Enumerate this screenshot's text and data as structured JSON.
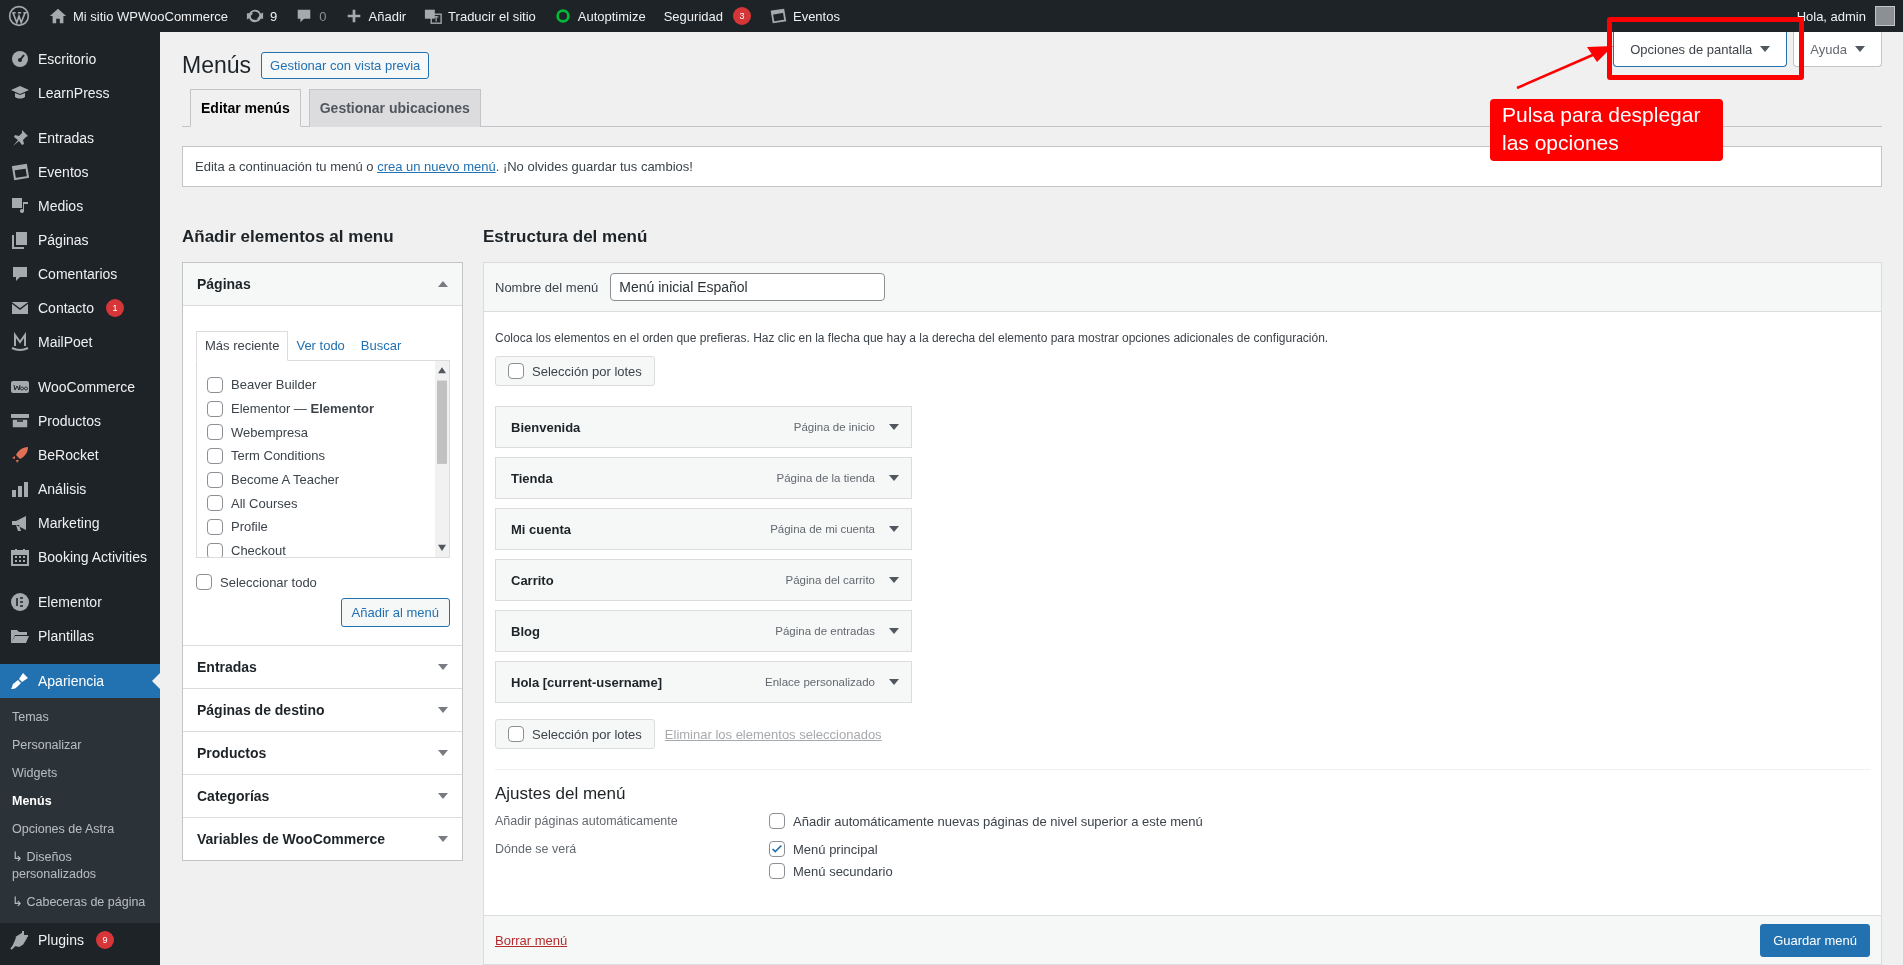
{
  "admin_bar": {
    "items": [
      {
        "kind": "home",
        "label": "Mi sitio WPWooCommerce",
        "muted": false
      },
      {
        "kind": "updates",
        "label": "9",
        "muted": false
      },
      {
        "kind": "comment",
        "label": "0",
        "muted": true
      },
      {
        "kind": "plus",
        "label": "Añadir",
        "muted": false
      },
      {
        "kind": "translate",
        "label": "Traducir el sitio",
        "muted": false
      },
      {
        "kind": "ring",
        "label": "Autoptimize",
        "muted": false
      },
      {
        "kind": "none",
        "label": "Seguridad",
        "badge": "3",
        "muted": false
      },
      {
        "kind": "calendar",
        "label": "Eventos",
        "muted": false
      }
    ],
    "greeting": "Hola, admin"
  },
  "sidebar": {
    "groups": [
      [
        {
          "kind": "gauge",
          "label": "Escritorio",
          "selected": false
        },
        {
          "kind": "cap",
          "label": "LearnPress",
          "selected": false
        }
      ],
      [
        {
          "kind": "pin",
          "label": "Entradas",
          "selected": false
        },
        {
          "kind": "calendar",
          "label": "Eventos",
          "selected": false
        },
        {
          "kind": "media",
          "label": "Medios",
          "selected": false
        },
        {
          "kind": "pages",
          "label": "Páginas",
          "selected": false
        },
        {
          "kind": "comment",
          "label": "Comentarios",
          "selected": false
        },
        {
          "kind": "mail",
          "label": "Contacto",
          "badge": "1",
          "selected": false
        },
        {
          "kind": "mletter",
          "label": "MailPoet",
          "selected": false
        }
      ],
      [
        {
          "kind": "woo",
          "label": "WooCommerce",
          "selected": false
        },
        {
          "kind": "archive",
          "label": "Productos",
          "selected": false
        },
        {
          "kind": "rocket",
          "label": "BeRocket",
          "selected": false
        },
        {
          "kind": "bars",
          "label": "Análisis",
          "selected": false
        },
        {
          "kind": "megaphone",
          "label": "Marketing",
          "selected": false
        },
        {
          "kind": "grid",
          "label": "Booking Activities",
          "selected": false
        }
      ],
      [
        {
          "kind": "elementor",
          "label": "Elementor",
          "selected": false
        },
        {
          "kind": "folder",
          "label": "Plantillas",
          "selected": false
        }
      ],
      [
        {
          "kind": "brush",
          "label": "Apariencia",
          "selected": true,
          "children": [
            {
              "label": "Temas",
              "selected": false
            },
            {
              "label": "Personalizar",
              "selected": false
            },
            {
              "label": "Widgets",
              "selected": false
            },
            {
              "label": "Menús",
              "selected": true
            },
            {
              "label": "Opciones de Astra",
              "selected": false
            },
            {
              "label": "↳ Diseños personalizados",
              "selected": false
            },
            {
              "label": "↳ Cabeceras de página",
              "selected": false
            }
          ]
        },
        {
          "kind": "plug",
          "label": "Plugins",
          "badge": "9",
          "selected": false
        }
      ]
    ]
  },
  "header": {
    "title": "Menús",
    "preview_button": "Gestionar con vista previa",
    "screen_options": "Opciones de pantalla",
    "help": "Ayuda"
  },
  "tabs": [
    {
      "label": "Editar menús",
      "selected": true
    },
    {
      "label": "Gestionar ubicaciones",
      "selected": false
    }
  ],
  "notice": {
    "before": "Edita a continuación tu menú o ",
    "link": "crea un nuevo menú",
    "after": ". ¡No olvides guardar tus cambios!"
  },
  "add_items": {
    "heading": "Añadir elementos al menu",
    "sections": [
      {
        "title": "Páginas",
        "expanded": true,
        "tabs": [
          {
            "label": "Más reciente",
            "selected": true
          },
          {
            "label": "Ver todo",
            "selected": false
          },
          {
            "label": "Buscar",
            "selected": false
          }
        ],
        "pages": [
          {
            "label": "Beaver Builder",
            "checked": false
          },
          {
            "label": "Elementor — **Elementor**",
            "checked": false
          },
          {
            "label": "Webempresa",
            "checked": false
          },
          {
            "label": "Term Conditions",
            "checked": false
          },
          {
            "label": "Become A Teacher",
            "checked": false
          },
          {
            "label": "All Courses",
            "checked": false
          },
          {
            "label": "Profile",
            "checked": false
          },
          {
            "label": "Checkout",
            "checked": false
          }
        ],
        "select_all": {
          "label": "Seleccionar todo",
          "checked": false
        },
        "add_button": "Añadir al menú"
      },
      {
        "title": "Entradas",
        "expanded": false
      },
      {
        "title": "Páginas de destino",
        "expanded": false
      },
      {
        "title": "Productos",
        "expanded": false
      },
      {
        "title": "Categorías",
        "expanded": false
      },
      {
        "title": "Variables de WooCommerce",
        "expanded": false
      }
    ]
  },
  "structure": {
    "heading": "Estructura del menú",
    "name_label": "Nombre del menú",
    "name_value": "Menú inicial Español",
    "instructions": "Coloca los elementos en el orden que prefieras. Haz clic en la flecha que hay a la derecha del elemento para mostrar opciones adicionales de configuración.",
    "bulk_top": {
      "label": "Selección por lotes",
      "checked": false
    },
    "items": [
      {
        "title": "Bienvenida",
        "type": "Página de inicio"
      },
      {
        "title": "Tienda",
        "type": "Página de la tienda"
      },
      {
        "title": "Mi cuenta",
        "type": "Página de mi cuenta"
      },
      {
        "title": "Carrito",
        "type": "Página del carrito"
      },
      {
        "title": "Blog",
        "type": "Página de entradas"
      },
      {
        "title": "Hola [current-username]",
        "type": "Enlace personalizado"
      }
    ],
    "bulk_bottom": {
      "label": "Selección por lotes",
      "checked": false
    },
    "remove_link": {
      "label": "Eliminar los elementos seleccionados",
      "disabled": true
    },
    "settings": {
      "heading": "Ajustes del menú",
      "rows": [
        {
          "label": "Añadir páginas automáticamente",
          "options": [
            {
              "label": "Añadir automáticamente nuevas páginas de nivel superior a este menú",
              "checked": false
            }
          ]
        },
        {
          "label": "Dónde se verá",
          "options": [
            {
              "label": "Menú principal",
              "checked": true
            },
            {
              "label": "Menú secundario",
              "checked": false
            }
          ]
        }
      ]
    },
    "delete_link": "Borrar menú",
    "save_button": "Guardar menú"
  },
  "annotation": {
    "text": "Pulsa para desplegar las opciones"
  }
}
